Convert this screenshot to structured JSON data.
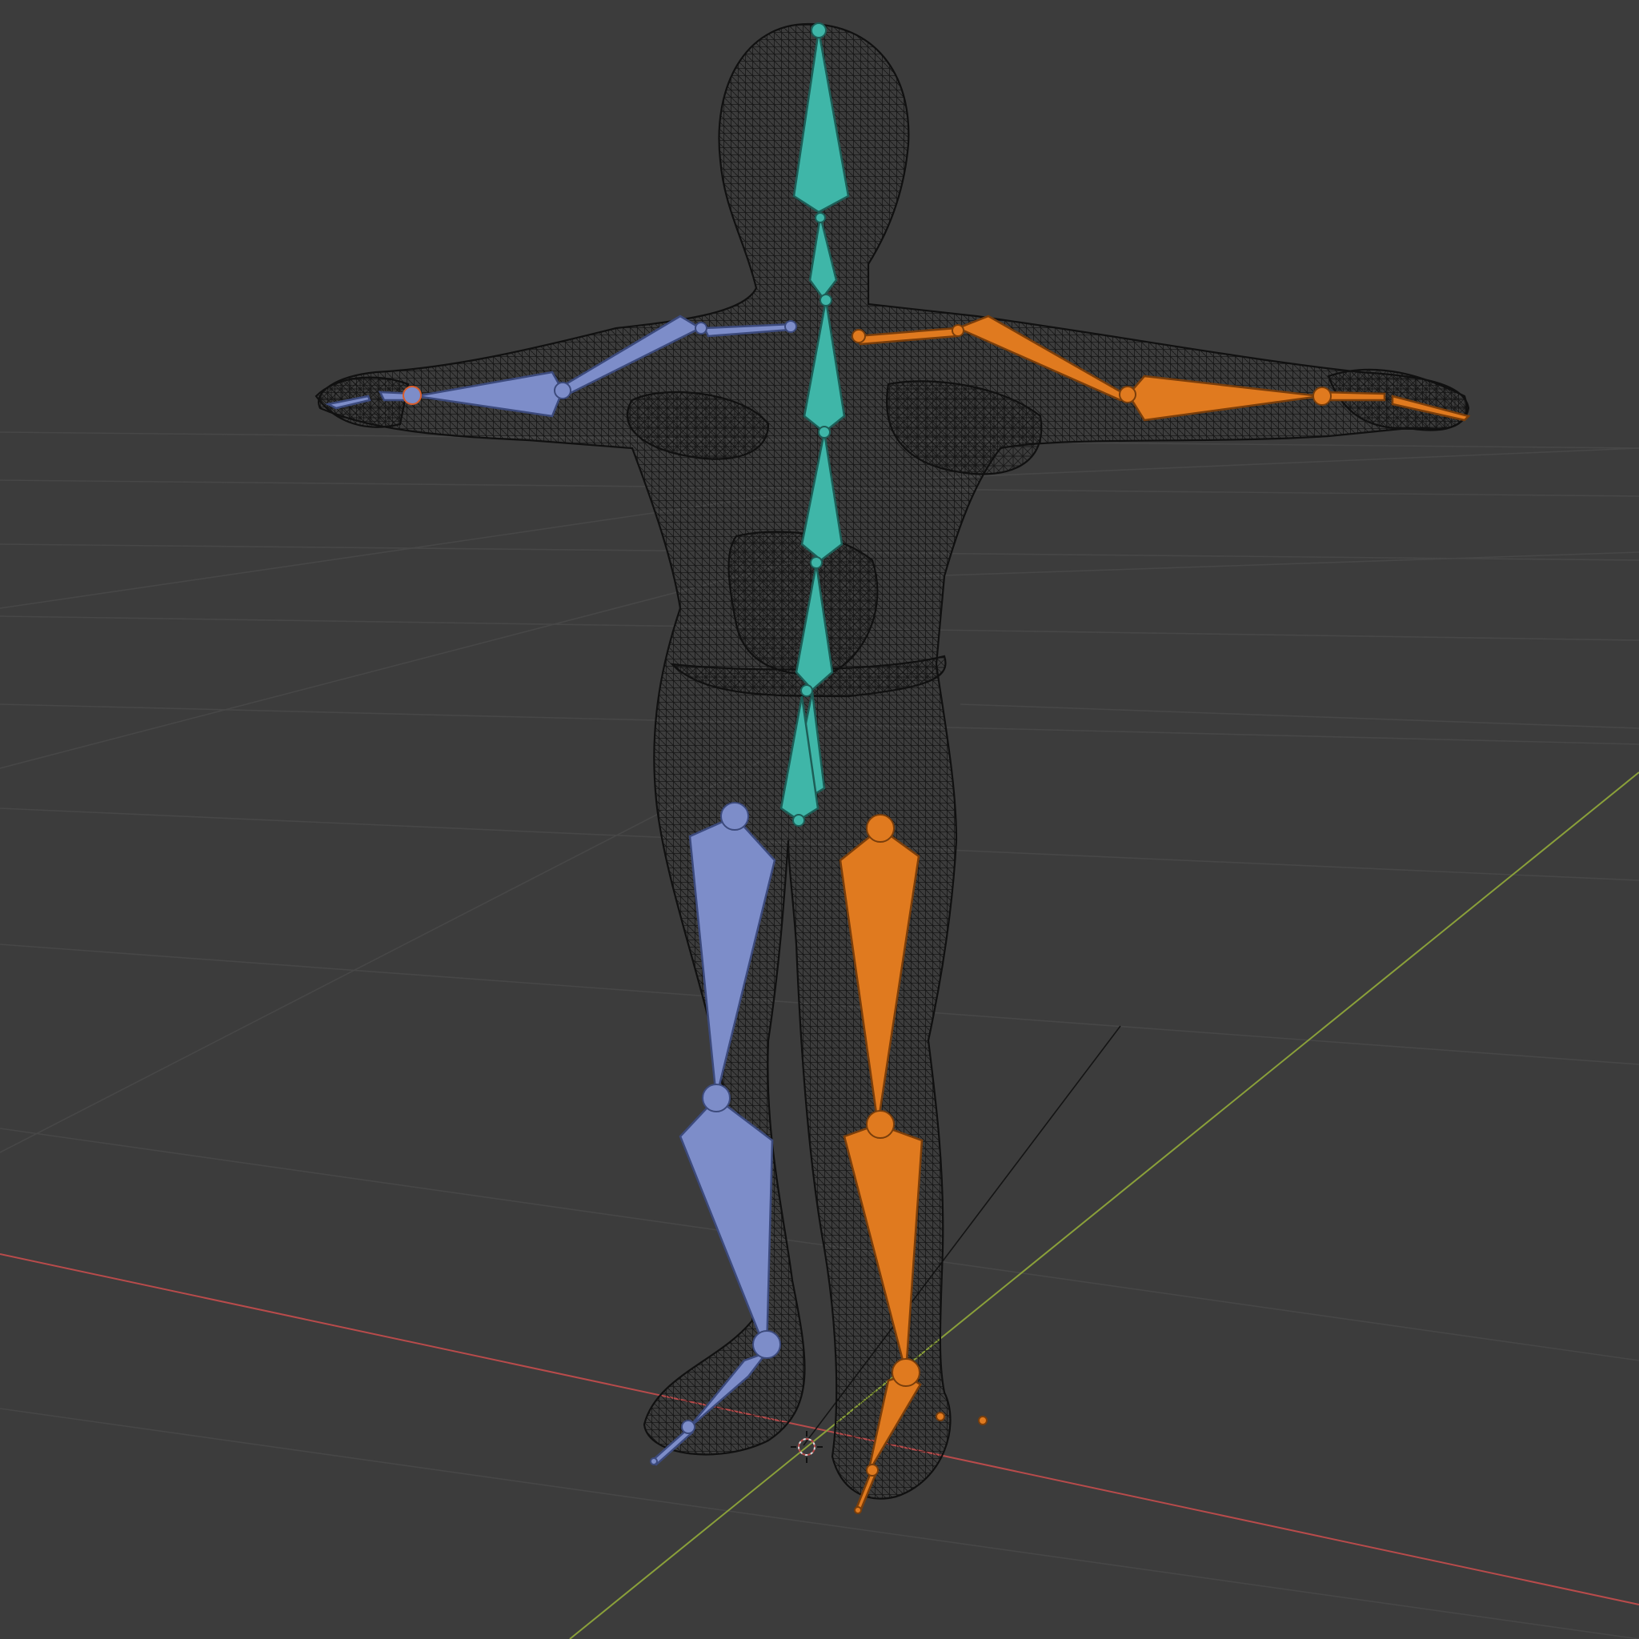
{
  "viewport": {
    "background": "#3c3c3c",
    "grid_color": "#474747",
    "axis_x_color": "#b84b4b",
    "axis_y_color": "#8aa03a",
    "mesh_color": "#101010"
  },
  "armature": {
    "center_color": "#3fb6a8",
    "left_color": "#7d8dc9",
    "right_color": "#e07a1f",
    "joint_outline": "#1e1e1e"
  },
  "scene": {
    "object": "character-mesh-wireframe",
    "pose": "T-pose",
    "display_mode": "wireframe"
  }
}
